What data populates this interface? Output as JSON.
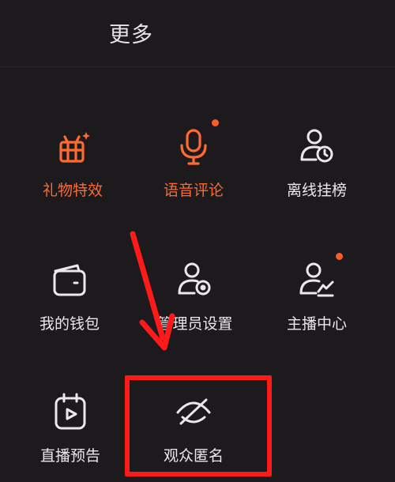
{
  "header": {
    "title": "更多"
  },
  "grid": {
    "row1": [
      {
        "label": "礼物特效",
        "icon": "gift-icon",
        "accent": true,
        "dot": false
      },
      {
        "label": "语音评论",
        "icon": "microphone-icon",
        "accent": true,
        "dot": true
      },
      {
        "label": "离线挂榜",
        "icon": "user-clock-icon",
        "accent": false,
        "dot": false
      }
    ],
    "row2": [
      {
        "label": "我的钱包",
        "icon": "wallet-icon",
        "accent": false,
        "dot": false
      },
      {
        "label": "管理员设置",
        "icon": "user-settings-icon",
        "accent": false,
        "dot": false
      },
      {
        "label": "主播中心",
        "icon": "user-chart-icon",
        "accent": false,
        "dot": true
      }
    ],
    "row3": [
      {
        "label": "直播预告",
        "icon": "calendar-play-icon",
        "accent": false,
        "dot": false
      },
      {
        "label": "观众匿名",
        "icon": "eye-off-icon",
        "accent": false,
        "dot": false
      }
    ]
  },
  "colors": {
    "background": "#1d1a1d",
    "accent": "#ff6a2e",
    "badge": "#ff5a2a",
    "annotation": "#ff1a1a",
    "text": "#ebe8eb"
  }
}
